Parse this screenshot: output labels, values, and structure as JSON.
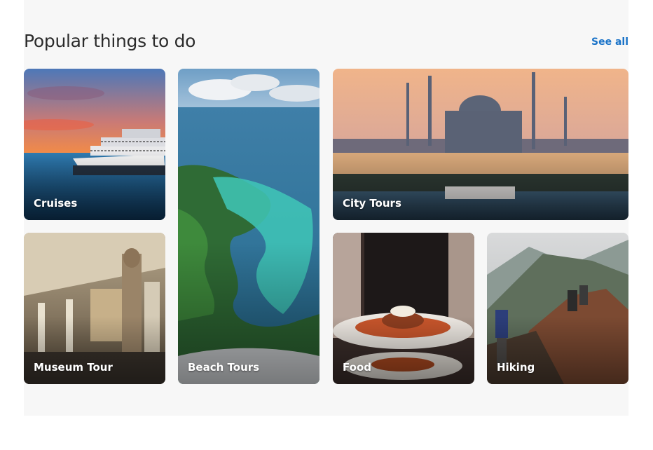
{
  "section": {
    "title": "Popular things to do",
    "see_all": "See all"
  },
  "cards": [
    {
      "label": "Cruises",
      "image": "cruise-ship-at-sunset"
    },
    {
      "label": "Beach Tours",
      "image": "aerial-tropical-lagoon"
    },
    {
      "label": "City Tours",
      "image": "mosque-skyline-at-dusk"
    },
    {
      "label": "Museum Tour",
      "image": "museum-hall-with-statue"
    },
    {
      "label": "Food",
      "image": "chef-holding-plated-dish"
    },
    {
      "label": "Hiking",
      "image": "hikers-on-mountain-ridge"
    }
  ]
}
